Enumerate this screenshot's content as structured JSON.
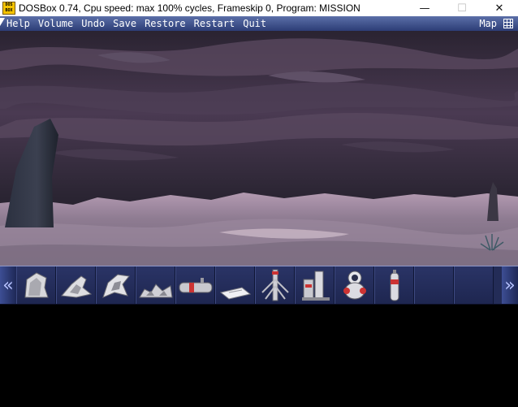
{
  "window": {
    "title": "DOSBox 0.74, Cpu speed: max 100% cycles, Frameskip  0, Program:  MISSION",
    "icon_label": "DOS BOX",
    "controls": {
      "minimize": "—",
      "maximize": "☐",
      "close": "✕"
    }
  },
  "menu": {
    "items": [
      "Help",
      "Volume",
      "Undo",
      "Save",
      "Restore",
      "Restart",
      "Quit"
    ],
    "right_label": "Map"
  },
  "inventory": {
    "left_arrow": "«",
    "right_arrow": "»",
    "slots": [
      {
        "icon": "rock-fragment-icon"
      },
      {
        "icon": "metal-shard-icon"
      },
      {
        "icon": "twisted-debris-icon"
      },
      {
        "icon": "broken-wreckage-icon"
      },
      {
        "icon": "canister-cylinder-icon"
      },
      {
        "icon": "paper-sheet-icon"
      },
      {
        "icon": "antenna-tower-icon"
      },
      {
        "icon": "gas-pump-machine-icon"
      },
      {
        "icon": "astronaut-robot-icon"
      },
      {
        "icon": "oxygen-tank-icon"
      },
      {
        "icon": "empty-slot"
      },
      {
        "icon": "empty-slot"
      }
    ]
  },
  "colors": {
    "menu_bar": "#2c3d76",
    "inventory_bar": "#232c57",
    "sky": "#3a3044",
    "ground": "#8b7a8d"
  }
}
